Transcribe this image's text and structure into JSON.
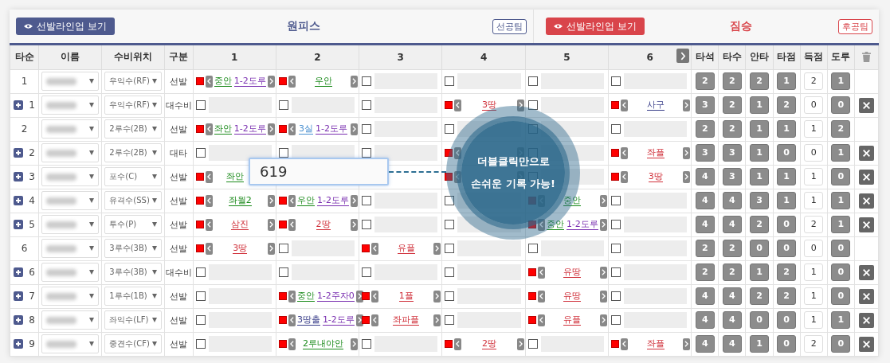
{
  "teams": [
    {
      "name": "원피스",
      "button": "선발라인업 보기",
      "badge": "선공팀",
      "color": "#4e5a8e"
    },
    {
      "name": "짐승",
      "button": "선발라인업 보기",
      "badge": "후공팀",
      "color": "#d9454b"
    }
  ],
  "table": {
    "columns": [
      "타순",
      "이름",
      "수비위치",
      "구분"
    ],
    "innings": [
      "1",
      "2",
      "3",
      "4",
      "5",
      "6"
    ],
    "next_inning_button": true,
    "stat_columns": [
      {
        "label": "타석",
        "kind": "badge"
      },
      {
        "label": "타수",
        "kind": "badge"
      },
      {
        "label": "안타",
        "kind": "badge"
      },
      {
        "label": "타점",
        "kind": "badge"
      },
      {
        "label": "득점",
        "kind": "field"
      },
      {
        "label": "도루",
        "kind": "badge"
      }
    ],
    "delete_all_button": true,
    "rows": [
      {
        "order": "1",
        "substitute": false,
        "position": "우익수(RF)",
        "role": "선발",
        "deletable": false,
        "stats": [
          "2",
          "2",
          "2",
          "1",
          "2",
          "1"
        ],
        "cells": [
          {
            "checked": true,
            "results": [
              {
                "text": "중안",
                "color": "#1a8a1a"
              },
              {
                "text": "1-2도루",
                "color": "#7a2fb0"
              }
            ]
          },
          {
            "checked": true,
            "results": [
              {
                "text": "우안",
                "color": "#1a8a1a"
              }
            ]
          },
          {
            "checked": false
          },
          {
            "checked": false
          },
          {
            "checked": false
          },
          {
            "checked": false
          }
        ]
      },
      {
        "order": "1",
        "substitute": true,
        "position": "우익수(RF)",
        "role": "대수비",
        "deletable": true,
        "stats": [
          "3",
          "2",
          "1",
          "2",
          "0",
          "0"
        ],
        "cells": [
          {
            "checked": false
          },
          {
            "checked": false
          },
          {
            "checked": false
          },
          {
            "checked": true,
            "results": [
              {
                "text": "3땅",
                "color": "#d0303a"
              }
            ]
          },
          {
            "checked": false
          },
          {
            "checked": true,
            "results": [
              {
                "text": "사구",
                "color": "#3a3f8a"
              }
            ]
          }
        ]
      },
      {
        "order": "2",
        "substitute": false,
        "position": "2루수(2B)",
        "role": "선발",
        "deletable": false,
        "stats": [
          "2",
          "2",
          "1",
          "1",
          "1",
          "2"
        ],
        "cells": [
          {
            "checked": true,
            "results": [
              {
                "text": "좌안",
                "color": "#1a8a1a"
              },
              {
                "text": "1-2도루",
                "color": "#7a2fb0"
              }
            ]
          },
          {
            "checked": true,
            "results": [
              {
                "text": "3실",
                "color": "#4a90d0"
              },
              {
                "text": "1-2도루",
                "color": "#7a2fb0"
              }
            ]
          },
          {
            "checked": false
          },
          {
            "checked": false
          },
          {
            "checked": false
          },
          {
            "checked": false
          }
        ]
      },
      {
        "order": "2",
        "substitute": true,
        "position": "2루수(2B)",
        "role": "대타",
        "deletable": true,
        "stats": [
          "3",
          "3",
          "1",
          "0",
          "0",
          "1"
        ],
        "cells": [
          {
            "checked": false
          },
          {
            "checked": false
          },
          {
            "checked": false
          },
          {
            "checked": true
          },
          {
            "checked": false
          },
          {
            "checked": true,
            "results": [
              {
                "text": "좌플",
                "color": "#d0303a"
              }
            ]
          }
        ]
      },
      {
        "order": "3",
        "substitute": true,
        "position": "포수(C)",
        "role": "선발",
        "deletable": true,
        "stats": [
          "4",
          "3",
          "1",
          "1",
          "1",
          "0"
        ],
        "cells": [
          {
            "checked": true,
            "results": [
              {
                "text": "좌안",
                "color": "#1a8a1a"
              }
            ]
          },
          {},
          {},
          {
            "checked": true
          },
          {
            "checked": false
          },
          {
            "checked": true,
            "results": [
              {
                "text": "3땅",
                "color": "#d0303a"
              }
            ]
          }
        ]
      },
      {
        "order": "4",
        "substitute": true,
        "position": "유격수(SS)",
        "role": "선발",
        "deletable": true,
        "stats": [
          "4",
          "4",
          "3",
          "1",
          "1",
          "1"
        ],
        "cells": [
          {
            "checked": true,
            "results": [
              {
                "text": "좌월2",
                "color": "#1a8a1a"
              }
            ]
          },
          {
            "checked": true,
            "results": [
              {
                "text": "우안",
                "color": "#1a8a1a"
              },
              {
                "text": "1-2도루",
                "color": "#7a2fb0"
              }
            ]
          },
          {
            "checked": false
          },
          {
            "checked": false
          },
          {
            "checked": true,
            "results": [
              {
                "text": "중안",
                "color": "#1a8a1a"
              }
            ]
          },
          {
            "checked": false
          }
        ]
      },
      {
        "order": "5",
        "substitute": true,
        "position": "투수(P)",
        "role": "선발",
        "deletable": true,
        "stats": [
          "4",
          "4",
          "2",
          "0",
          "2",
          "1"
        ],
        "cells": [
          {
            "checked": true,
            "results": [
              {
                "text": "삼진",
                "color": "#d0303a"
              }
            ]
          },
          {
            "checked": true,
            "results": [
              {
                "text": "2땅",
                "color": "#d0303a"
              }
            ]
          },
          {
            "checked": false
          },
          {
            "checked": false
          },
          {
            "checked": true,
            "results": [
              {
                "text": "중안",
                "color": "#1a8a1a"
              },
              {
                "text": "1-2도루",
                "color": "#7a2fb0"
              }
            ]
          },
          {
            "checked": false
          }
        ]
      },
      {
        "order": "6",
        "substitute": false,
        "position": "3루수(3B)",
        "role": "선발",
        "deletable": false,
        "stats": [
          "2",
          "2",
          "0",
          "0",
          "0",
          "0"
        ],
        "cells": [
          {
            "checked": true,
            "results": [
              {
                "text": "3땅",
                "color": "#d0303a"
              }
            ]
          },
          {
            "checked": false
          },
          {
            "checked": true,
            "results": [
              {
                "text": "유플",
                "color": "#d0303a"
              }
            ]
          },
          {
            "checked": false
          },
          {
            "checked": false
          },
          {
            "checked": false
          }
        ]
      },
      {
        "order": "6",
        "substitute": true,
        "position": "3루수(3B)",
        "role": "대수비",
        "deletable": true,
        "stats": [
          "2",
          "2",
          "1",
          "2",
          "1",
          "0"
        ],
        "cells": [
          {
            "checked": false
          },
          {
            "checked": false
          },
          {
            "checked": false
          },
          {
            "checked": false
          },
          {
            "checked": true,
            "results": [
              {
                "text": "유땅",
                "color": "#d0303a"
              }
            ]
          },
          {
            "checked": false
          }
        ]
      },
      {
        "order": "7",
        "substitute": true,
        "position": "1루수(1B)",
        "role": "선발",
        "deletable": true,
        "stats": [
          "4",
          "4",
          "2",
          "2",
          "1",
          "0"
        ],
        "cells": [
          {
            "checked": false
          },
          {
            "checked": true,
            "results": [
              {
                "text": "중안",
                "color": "#1a8a1a"
              },
              {
                "text": "1-2주자0",
                "color": "#7a2fb0"
              }
            ]
          },
          {
            "checked": true,
            "results": [
              {
                "text": "1플",
                "color": "#d0303a"
              }
            ]
          },
          {
            "checked": false
          },
          {
            "checked": true,
            "results": [
              {
                "text": "유땅",
                "color": "#d0303a"
              }
            ]
          },
          {
            "checked": false
          }
        ]
      },
      {
        "order": "8",
        "substitute": true,
        "position": "좌익수(LF)",
        "role": "선발",
        "deletable": true,
        "stats": [
          "4",
          "4",
          "0",
          "0",
          "1",
          "1"
        ],
        "cells": [
          {
            "checked": false
          },
          {
            "checked": true,
            "results": [
              {
                "text": "3땅출",
                "color": "#3a3f8a"
              },
              {
                "text": "1-2도루",
                "color": "#7a2fb0"
              }
            ]
          },
          {
            "checked": true,
            "results": [
              {
                "text": "좌파플",
                "color": "#d0303a"
              }
            ]
          },
          {
            "checked": false
          },
          {
            "checked": true,
            "results": [
              {
                "text": "유플",
                "color": "#d0303a"
              }
            ]
          },
          {
            "checked": false
          }
        ]
      },
      {
        "order": "9",
        "substitute": true,
        "position": "중견수(CF)",
        "role": "선발",
        "deletable": true,
        "stats": [
          "4",
          "4",
          "1",
          "0",
          "2",
          "0"
        ],
        "cells": [
          {
            "checked": false
          },
          {
            "checked": true,
            "results": [
              {
                "text": "2루내야안",
                "color": "#1a8a1a"
              }
            ]
          },
          {
            "checked": false
          },
          {
            "checked": true,
            "results": [
              {
                "text": "2땅",
                "color": "#d0303a"
              }
            ]
          },
          {
            "checked": false
          },
          {
            "checked": true,
            "results": [
              {
                "text": "좌플",
                "color": "#d0303a"
              }
            ]
          }
        ]
      }
    ]
  },
  "edit_popup": {
    "value": "619"
  },
  "callout": {
    "lines": [
      "더블클릭만으로",
      "손쉬운 기록 가능!"
    ]
  }
}
